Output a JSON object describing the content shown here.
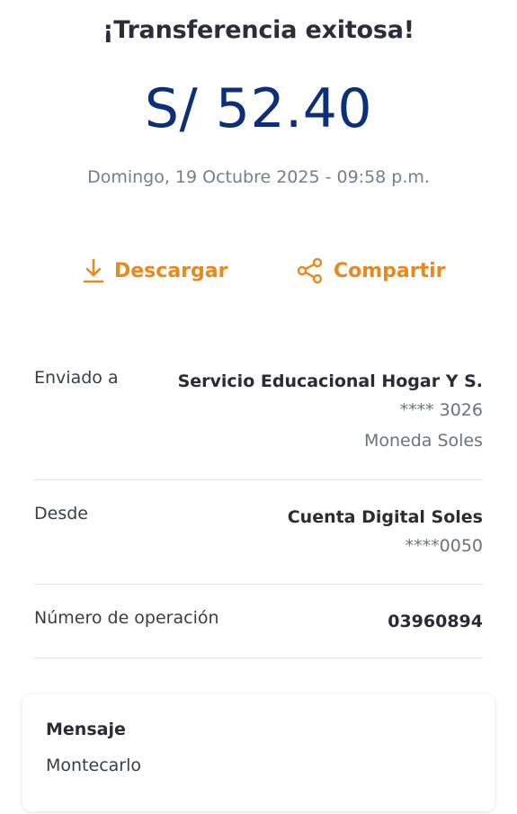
{
  "header": {
    "title": "¡Transferencia exitosa!",
    "amount": "S/ 52.40",
    "date": "Domingo, 19 Octubre 2025 - 09:58 p.m."
  },
  "actions": {
    "download_label": "Descargar",
    "download_icon": "download-icon",
    "share_label": "Compartir",
    "share_icon": "share-icon",
    "accent_color": "#e8891e"
  },
  "details": {
    "sent_to": {
      "label": "Enviado a",
      "name": "Servicio Educacional Hogar Y S.",
      "account": "**** 3026",
      "currency": "Moneda Soles"
    },
    "from": {
      "label": "Desde",
      "name": "Cuenta Digital Soles",
      "account": "****0050"
    },
    "operation": {
      "label": "Número de operación",
      "value": "03960894"
    }
  },
  "message": {
    "title": "Mensaje",
    "text": "Montecarlo"
  },
  "colors": {
    "amount": "#0d2f7a",
    "divider": "#e3e4e8"
  }
}
